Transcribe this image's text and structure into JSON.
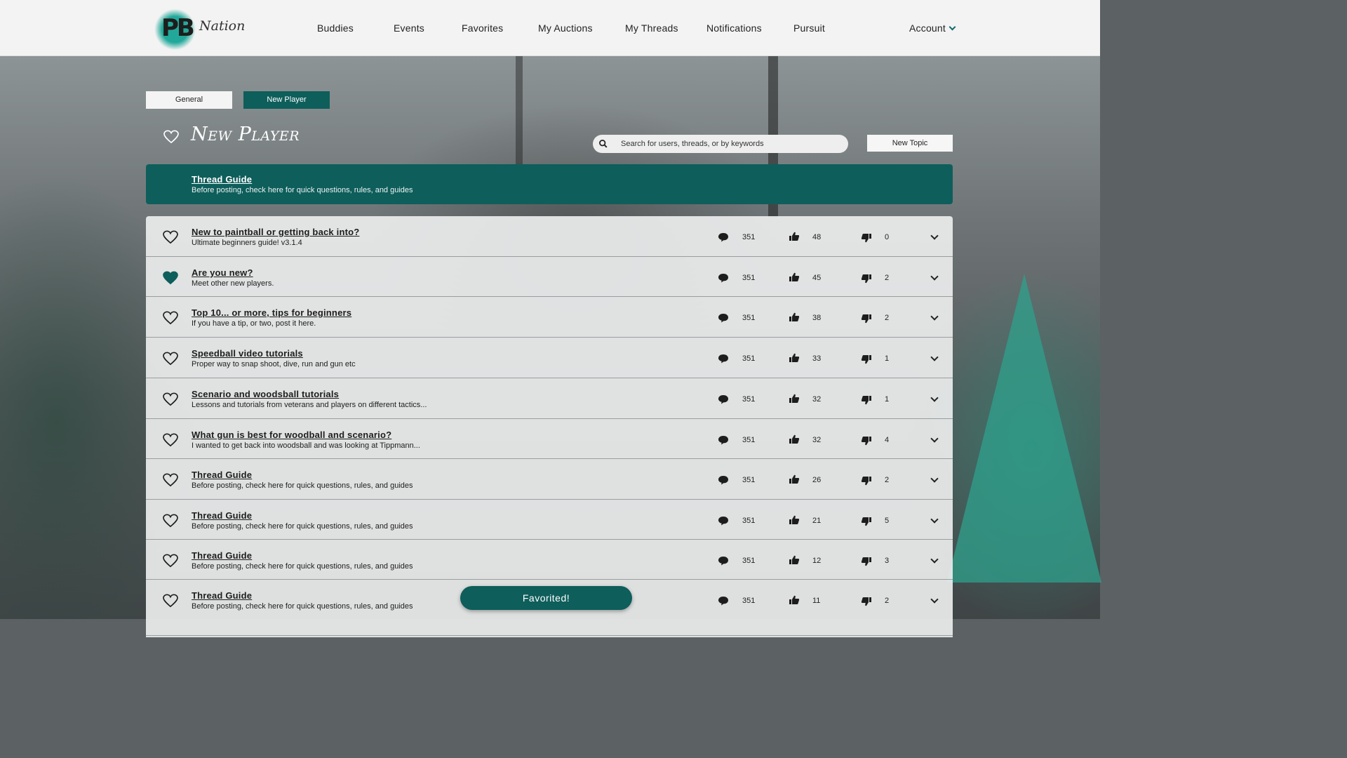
{
  "brand": {
    "logo_text": "PB",
    "logo_word": "Nation"
  },
  "nav": {
    "items": [
      "Buddies",
      "Events",
      "Favorites",
      "My Auctions",
      "My Threads",
      "Notifications",
      "Pursuit"
    ],
    "account_label": "Account"
  },
  "tabs": [
    {
      "label": "General",
      "active": false
    },
    {
      "label": "New Player",
      "active": true
    }
  ],
  "page": {
    "title": "New Player",
    "search_placeholder": "Search for users, threads, or by keywords",
    "new_topic_label": "New Topic"
  },
  "pinned": {
    "title": "Thread Guide",
    "subtitle": "Before posting, check here for quick questions, rules, and guides"
  },
  "threads": [
    {
      "title": "New to paintball or getting back into?",
      "subtitle": "Ultimate beginners guide! v3.1.4",
      "comments": "351",
      "likes": "48",
      "dislikes": "0",
      "favorited": false
    },
    {
      "title": "Are you new?",
      "subtitle": "Meet other new players.",
      "comments": "351",
      "likes": "45",
      "dislikes": "2",
      "favorited": true
    },
    {
      "title": "Top 10... or more, tips for beginners",
      "subtitle": "If you have a tip, or two, post it here.",
      "comments": "351",
      "likes": "38",
      "dislikes": "2",
      "favorited": false
    },
    {
      "title": "Speedball video tutorials",
      "subtitle": "Proper way to snap shoot, dive, run and gun etc",
      "comments": "351",
      "likes": "33",
      "dislikes": "1",
      "favorited": false
    },
    {
      "title": "Scenario and woodsball tutorials",
      "subtitle": "Lessons and tutorials from veterans and players on different tactics...",
      "comments": "351",
      "likes": "32",
      "dislikes": "1",
      "favorited": false
    },
    {
      "title": "What gun is best for woodball and scenario?",
      "subtitle": "I wanted to get back into woodsball and was looking at Tippmann...",
      "comments": "351",
      "likes": "32",
      "dislikes": "4",
      "favorited": false
    },
    {
      "title": "Thread Guide",
      "subtitle": "Before posting, check here for quick questions, rules, and guides",
      "comments": "351",
      "likes": "26",
      "dislikes": "2",
      "favorited": false
    },
    {
      "title": "Thread Guide",
      "subtitle": "Before posting, check here for quick questions, rules, and guides",
      "comments": "351",
      "likes": "21",
      "dislikes": "5",
      "favorited": false
    },
    {
      "title": "Thread Guide",
      "subtitle": "Before posting, check here for quick questions, rules, and guides",
      "comments": "351",
      "likes": "12",
      "dislikes": "3",
      "favorited": false
    },
    {
      "title": "Thread Guide",
      "subtitle": "Before posting, check here for quick questions, rules, and guides",
      "comments": "351",
      "likes": "11",
      "dislikes": "2",
      "favorited": false
    }
  ],
  "toast": {
    "message": "Favorited!"
  },
  "colors": {
    "accent": "#0e5e5b",
    "header_bg": "#f3f3f3",
    "favorite_fill": "#0e5e5b"
  }
}
